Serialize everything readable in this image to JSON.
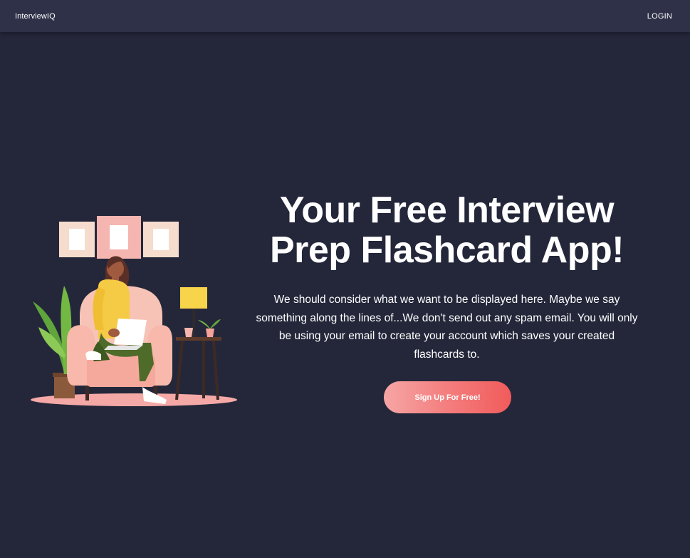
{
  "navbar": {
    "brand": "InterviewIQ",
    "login_label": "LOGIN"
  },
  "hero": {
    "headline": "Your Free Interview Prep Flashcard App!",
    "body": "We should consider what we want to be displayed here. Maybe we say something along the lines of...We don't send out any spam email. You will only be using your email to create your account which saves your created flashcards to.",
    "cta_label": "Sign Up For Free!"
  },
  "colors": {
    "background": "#24273a",
    "navbar": "#2e3148",
    "cta_start": "#f6a5a5",
    "cta_end": "#f15b5b"
  }
}
